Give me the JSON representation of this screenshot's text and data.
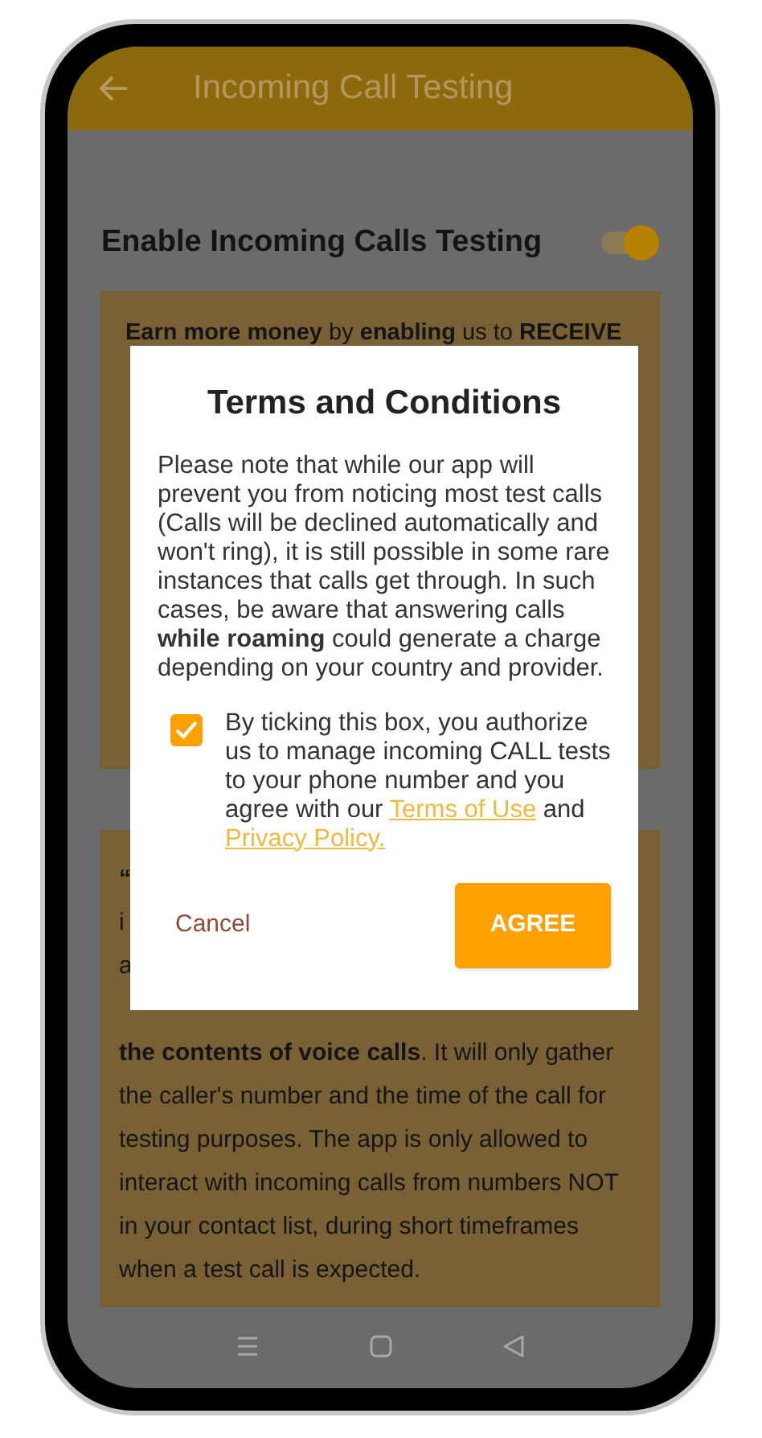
{
  "app_bar": {
    "title": "Incoming Call Testing"
  },
  "setting": {
    "label": "Enable Incoming Calls Testing",
    "on": true
  },
  "card_1": {
    "text": "**Earn more money** by **enabling** us to **RECEIVE**"
  },
  "card_2": {
    "fragments": [
      "“",
      "i",
      "a"
    ],
    "paragraph": "**the contents of voice calls**. It will only gather the caller's number and the time of the call for testing purposes. The app is only allowed to interact with incoming calls from numbers NOT in your contact list, during short timeframes when a test call is expected."
  },
  "dialog": {
    "title": "Terms and Conditions",
    "body": "Please note that while our app will prevent you from noticing most test calls (Calls will be declined automatically and won't ring), it is still possible in some rare instances that calls get through. In such cases, be aware that answering calls **while roaming** could generate a charge depending on your country and provider.",
    "consent": {
      "checked": true,
      "text": "By ticking this box, you authorize us to manage incoming CALL tests to your phone number and you agree with our",
      "terms_link": "Terms of Use",
      "joiner": "and",
      "privacy_link": "Privacy Policy."
    },
    "buttons": [
      {
        "label": "Cancel",
        "kind": "text"
      },
      {
        "label": "AGREE",
        "kind": "filled"
      }
    ]
  }
}
